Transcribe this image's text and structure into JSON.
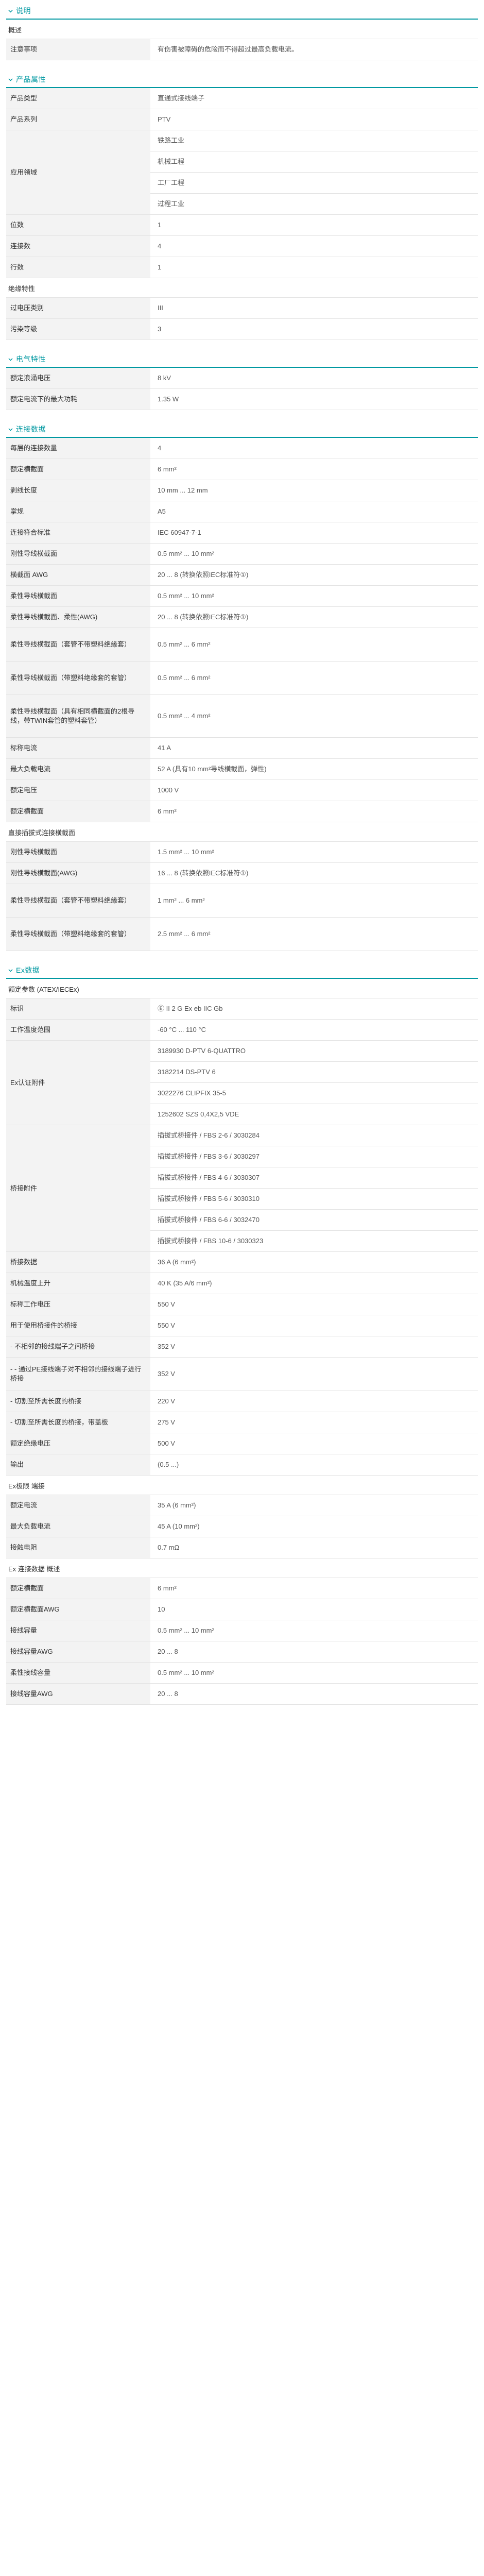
{
  "colors": {
    "accent": "#0098a1",
    "label_bg": "#f3f3f3",
    "divider": "#e3e3e3"
  },
  "sections": [
    {
      "title": "说明",
      "blocks": [
        {
          "subtitle": "概述",
          "rows": [
            {
              "k": "注意事项",
              "v": [
                "有伤害被障碍的危险而不得超过最高负载电流。"
              ]
            }
          ]
        }
      ]
    },
    {
      "title": "产品属性",
      "blocks": [
        {
          "subtitle": "",
          "rows": [
            {
              "k": "产品类型",
              "v": [
                "直通式接线端子"
              ]
            },
            {
              "k": "产品系列",
              "v": [
                "PTV"
              ]
            },
            {
              "k": "应用领域",
              "v": [
                "铁路工业",
                "机械工程",
                "工厂工程",
                "过程工业"
              ]
            },
            {
              "k": "位数",
              "v": [
                "1"
              ]
            },
            {
              "k": "连接数",
              "v": [
                "4"
              ]
            },
            {
              "k": "行数",
              "v": [
                "1"
              ]
            }
          ]
        },
        {
          "subtitle": "绝缘特性",
          "rows": [
            {
              "k": "过电压类别",
              "v": [
                "III"
              ]
            },
            {
              "k": "污染等级",
              "v": [
                "3"
              ]
            }
          ]
        }
      ]
    },
    {
      "title": "电气特性",
      "blocks": [
        {
          "subtitle": "",
          "rows": [
            {
              "k": "额定浪涌电压",
              "v": [
                "8 kV"
              ]
            },
            {
              "k": "额定电流下的最大功耗",
              "v": [
                "1.35 W"
              ]
            }
          ]
        }
      ]
    },
    {
      "title": "连接数据",
      "blocks": [
        {
          "subtitle": "",
          "rows": [
            {
              "k": "每层的连接数量",
              "v": [
                "4"
              ]
            },
            {
              "k": "额定横截面",
              "v": [
                "6 mm²"
              ]
            },
            {
              "k": "剥线长度",
              "v": [
                "10 mm ... 12 mm"
              ]
            },
            {
              "k": "掌规",
              "v": [
                "A5"
              ]
            },
            {
              "k": "连接符合标准",
              "v": [
                "IEC 60947-7-1"
              ]
            },
            {
              "k": "刚性导线横截面",
              "v": [
                "0.5 mm² ... 10 mm²"
              ]
            },
            {
              "k": "横截面 AWG",
              "v": [
                "20 ... 8 (转换依照IEC标准符①)"
              ]
            },
            {
              "k": "柔性导线横截面",
              "v": [
                "0.5 mm² ... 10 mm²"
              ]
            },
            {
              "k": "柔性导线横截面、柔性(AWG)",
              "v": [
                "20 ... 8 (转换依照IEC标准符①)"
              ]
            },
            {
              "k": "柔性导线横截面（套管不带塑料绝缘套）",
              "v": [
                "0.5 mm² ... 6 mm²"
              ],
              "tall": 1
            },
            {
              "k": "柔性导线横截面（带塑料绝缘套的套管）",
              "v": [
                "0.5 mm² ... 6 mm²"
              ],
              "tall": 1
            },
            {
              "k": "柔性导线横截面（具有相同横截面的2根导线，带TWIN套管的塑料套管）",
              "v": [
                "0.5 mm² ... 4 mm²"
              ],
              "tall": 2
            },
            {
              "k": "标称电流",
              "v": [
                "41 A"
              ]
            },
            {
              "k": "最大负载电流",
              "v": [
                "52 A (具有10 mm²导线横截面，弹性)"
              ]
            },
            {
              "k": "额定电压",
              "v": [
                "1000 V"
              ]
            },
            {
              "k": "额定横截面",
              "v": [
                "6 mm²"
              ]
            }
          ]
        },
        {
          "subtitle": "直接插拔式连接横截面",
          "rows": [
            {
              "k": "刚性导线横截面",
              "v": [
                "1.5 mm² ... 10 mm²"
              ]
            },
            {
              "k": "刚性导线横截面(AWG)",
              "v": [
                "16 ... 8 (转换依照IEC标准符①)"
              ]
            },
            {
              "k": "柔性导线横截面（套管不带塑料绝缘套）",
              "v": [
                "1 mm² ... 6 mm²"
              ],
              "tall": 1
            },
            {
              "k": "柔性导线横截面（带塑料绝缘套的套管）",
              "v": [
                "2.5 mm² ... 6 mm²"
              ],
              "tall": 1
            }
          ]
        }
      ]
    },
    {
      "title": "Ex数据",
      "blocks": [
        {
          "subtitle": "额定参数 (ATEX/IECEx)",
          "rows": [
            {
              "k": "标识",
              "v": [
                "Ⓔ II 2 G Ex eb IIC Gb"
              ]
            },
            {
              "k": "工作温度范围",
              "v": [
                "-60 °C ... 110 °C"
              ]
            },
            {
              "k": "Ex认证附件",
              "v": [
                "3189930 D-PTV 6-QUATTRO",
                "3182214 DS-PTV 6",
                "3022276 CLIPFIX 35-5",
                "1252602 SZS 0,4X2,5 VDE"
              ]
            },
            {
              "k": "桥接附件",
              "v": [
                "插拔式桥接件 / FBS 2-6 / 3030284",
                "插拔式桥接件 / FBS 3-6 / 3030297",
                "插拔式桥接件 / FBS 4-6 / 3030307",
                "插拔式桥接件 / FBS 5-6 / 3030310",
                "插拔式桥接件 / FBS 6-6 / 3032470",
                "插拔式桥接件 / FBS 10-6 / 3030323"
              ]
            },
            {
              "k": "桥接数据",
              "v": [
                "36 A (6 mm²)"
              ]
            },
            {
              "k": "机械温度上升",
              "v": [
                "40 K (35 A/6 mm²)"
              ]
            },
            {
              "k": "标称工作电压",
              "v": [
                "550 V"
              ]
            },
            {
              "k": "用于使用桥接件的桥接",
              "v": [
                "550 V"
              ]
            },
            {
              "k": "- 不相邻的接线端子之间桥接",
              "v": [
                "352 V"
              ]
            },
            {
              "k": "- - 通过PE接线端子对不相邻的接线端子进行桥接",
              "v": [
                "352 V"
              ],
              "tall": 1
            },
            {
              "k": "- 切割至所需长度的桥接",
              "v": [
                "220 V"
              ]
            },
            {
              "k": "- 切割至所需长度的桥接，带盖板",
              "v": [
                "275 V"
              ]
            },
            {
              "k": "额定绝缘电压",
              "v": [
                "500 V"
              ]
            },
            {
              "k": "输出",
              "v": [
                "(0.5 ...)"
              ]
            }
          ]
        },
        {
          "subtitle": "Ex极限 端接",
          "rows": [
            {
              "k": "额定电流",
              "v": [
                "35 A (6 mm²)"
              ]
            },
            {
              "k": "最大负载电流",
              "v": [
                "45 A (10 mm²)"
              ]
            },
            {
              "k": "接触电阻",
              "v": [
                "0.7 mΩ"
              ]
            }
          ]
        },
        {
          "subtitle": "Ex 连接数据 概述",
          "rows": [
            {
              "k": "额定横截面",
              "v": [
                "6 mm²"
              ]
            },
            {
              "k": "额定横截面AWG",
              "v": [
                "10"
              ]
            },
            {
              "k": "接线容量",
              "v": [
                "0.5 mm² ... 10 mm²"
              ]
            },
            {
              "k": "接线容量AWG",
              "v": [
                "20 ... 8"
              ]
            },
            {
              "k": "柔性接线容量",
              "v": [
                "0.5 mm² ... 10 mm²"
              ]
            },
            {
              "k": "接线容量AWG",
              "v": [
                "20 ... 8"
              ]
            }
          ]
        }
      ]
    }
  ]
}
